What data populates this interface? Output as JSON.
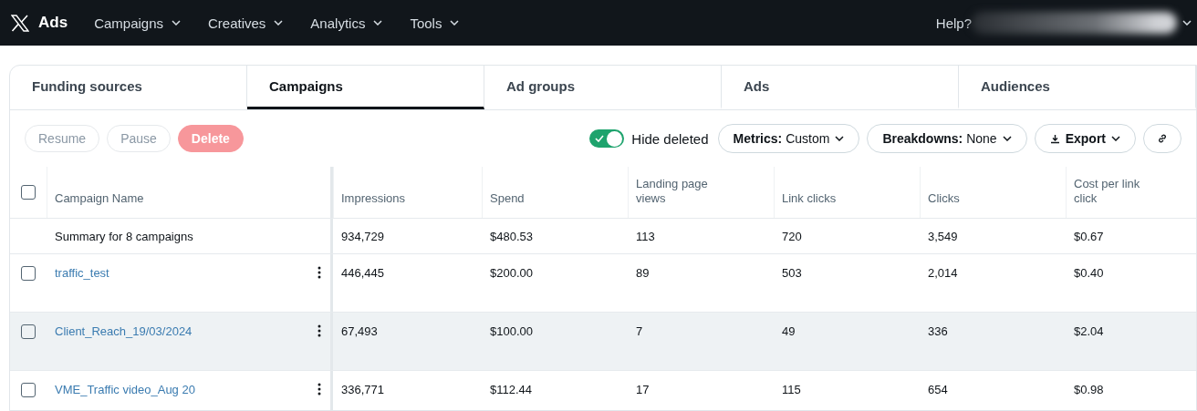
{
  "nav": {
    "brand": "Ads",
    "menus": [
      {
        "label": "Campaigns"
      },
      {
        "label": "Creatives"
      },
      {
        "label": "Analytics"
      },
      {
        "label": "Tools"
      }
    ],
    "help": "Help?"
  },
  "tabs": [
    {
      "label": "Funding sources",
      "selected": false
    },
    {
      "label": "Campaigns",
      "selected": true
    },
    {
      "label": "Ad groups",
      "selected": false
    },
    {
      "label": "Ads",
      "selected": false
    },
    {
      "label": "Audiences",
      "selected": false
    }
  ],
  "toolbar": {
    "actions": [
      {
        "label": "Resume",
        "kind": "plain",
        "disabled": true
      },
      {
        "label": "Pause",
        "kind": "plain",
        "disabled": true
      },
      {
        "label": "Delete",
        "kind": "danger",
        "disabled": true
      }
    ],
    "toggle": {
      "label": "Hide deleted",
      "on": true
    },
    "menus": [
      {
        "label": "**Metrics:** Custom"
      },
      {
        "label": "**Breakdowns:** None"
      }
    ],
    "export": "Export"
  },
  "table": {
    "select_all": {
      "checked": false
    },
    "columns": [
      "Campaign Name",
      "Impressions",
      "Spend",
      "Landing page views",
      "Link clicks",
      "Clicks",
      "Cost per link click"
    ],
    "summary": [
      "Summary for 8 campaigns",
      "934,729",
      "$480.53",
      "113",
      "720",
      "3,549",
      "$0.67"
    ],
    "rows": [
      {
        "checked": false,
        "highlighted": false,
        "cells": [
          "traffic_test",
          "446,445",
          "$200.00",
          "89",
          "503",
          "2,014",
          "$0.40"
        ]
      },
      {
        "checked": false,
        "highlighted": true,
        "cells": [
          "Client_Reach_19/03/2024",
          "67,493",
          "$100.00",
          "7",
          "49",
          "336",
          "$2.04"
        ]
      },
      {
        "checked": false,
        "highlighted": false,
        "cells": [
          "VME_Traffic video_Aug 20",
          "336,771",
          "$112.44",
          "17",
          "115",
          "654",
          "$0.98"
        ]
      }
    ]
  }
}
